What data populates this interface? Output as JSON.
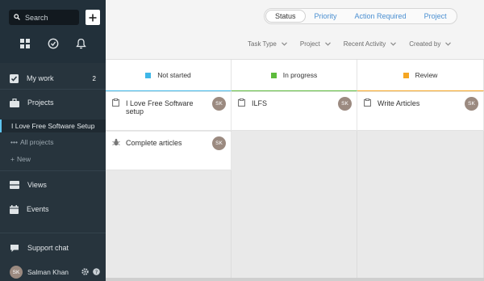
{
  "sidebar": {
    "search_label": "Search",
    "nav": {
      "my_work": "My work",
      "my_work_count": "2",
      "projects": "Projects",
      "active_project": "I Love Free Software Setup",
      "all_projects": "All projects",
      "new": "New",
      "views": "Views",
      "events": "Events",
      "support_chat": "Support chat"
    },
    "user": {
      "name": "Salman Khan",
      "initials": "SK"
    }
  },
  "header": {
    "tabs": [
      "Status",
      "Priority",
      "Action Required",
      "Project"
    ],
    "active_tab": "Status",
    "filters": [
      "Task Type",
      "Project",
      "Recent Activity",
      "Created by"
    ]
  },
  "board": {
    "columns": [
      {
        "name": "Not started",
        "color": "#3fb7e8"
      },
      {
        "name": "In progress",
        "color": "#5dbb3c"
      },
      {
        "name": "Review",
        "color": "#f5a623"
      }
    ],
    "cards": {
      "c1": {
        "title_line1": "I Love Free Software",
        "title_line2": "setup",
        "assignee": "SK"
      },
      "c2": {
        "title": "Complete articles",
        "assignee": "SK"
      },
      "c3": {
        "title": "ILFS",
        "assignee": "SK"
      },
      "c4": {
        "title": "Write Articles",
        "assignee": "SK"
      }
    }
  }
}
